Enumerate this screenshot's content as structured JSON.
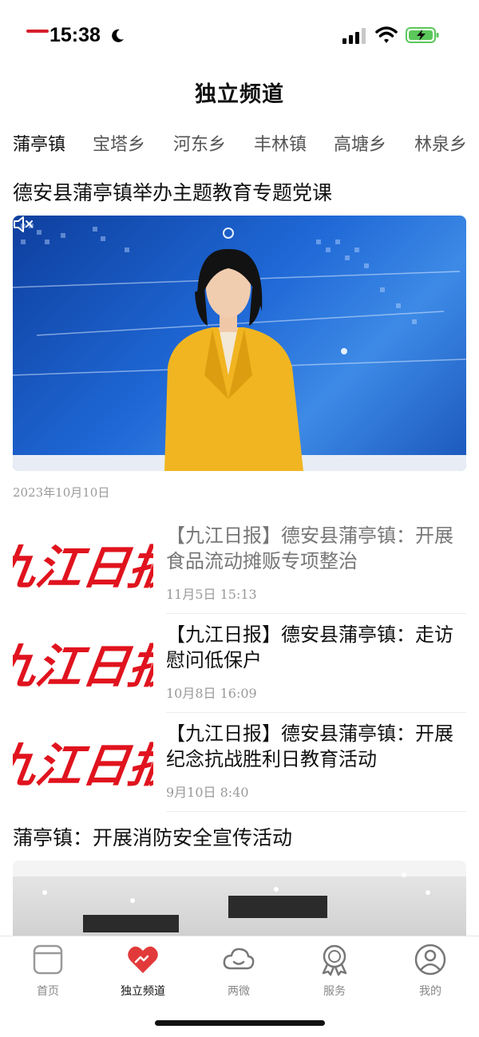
{
  "status_bar": {
    "time": "15:38",
    "icons": [
      "moon-icon",
      "signal-icon",
      "wifi-icon",
      "battery-charging-icon"
    ]
  },
  "page": {
    "title": "独立频道"
  },
  "tabs": [
    {
      "label": "蒲亭镇",
      "active": true
    },
    {
      "label": "宝塔乡",
      "active": false
    },
    {
      "label": "河东乡",
      "active": false
    },
    {
      "label": "丰林镇",
      "active": false
    },
    {
      "label": "高塘乡",
      "active": false
    },
    {
      "label": "林泉乡",
      "active": false
    }
  ],
  "featured": {
    "title": "德安县蒲亭镇举办主题教育专题党课",
    "date": "2023年10月10日",
    "muted_icon": "speaker-muted-icon"
  },
  "news": [
    {
      "title": "【九江日报】德安县蒲亭镇：开展食品流动摊贩专项整治",
      "time": "11月5日  15:13",
      "read": true,
      "thumb_text": "九江日报"
    },
    {
      "title": "【九江日报】德安县蒲亭镇：走访慰问低保户",
      "time": "10月8日  16:09",
      "read": false,
      "thumb_text": "九江日报"
    },
    {
      "title": "【九江日报】德安县蒲亭镇：开展纪念抗战胜利日教育活动",
      "time": "9月10日  8:40",
      "read": false,
      "thumb_text": "九江日报"
    }
  ],
  "second_featured": {
    "title": "蒲亭镇：开展消防安全宣传活动"
  },
  "bottom_nav": [
    {
      "label": "首页",
      "icon": "home-icon",
      "active": false
    },
    {
      "label": "独立频道",
      "icon": "heart-hands-icon",
      "active": true
    },
    {
      "label": "两微",
      "icon": "cloud-icon",
      "active": false
    },
    {
      "label": "服务",
      "icon": "badge-icon",
      "active": false
    },
    {
      "label": "我的",
      "icon": "user-icon",
      "active": false
    }
  ],
  "colors": {
    "accent": "#d6202c",
    "video_blue": "#1f68d6",
    "muted_text": "#999999"
  }
}
